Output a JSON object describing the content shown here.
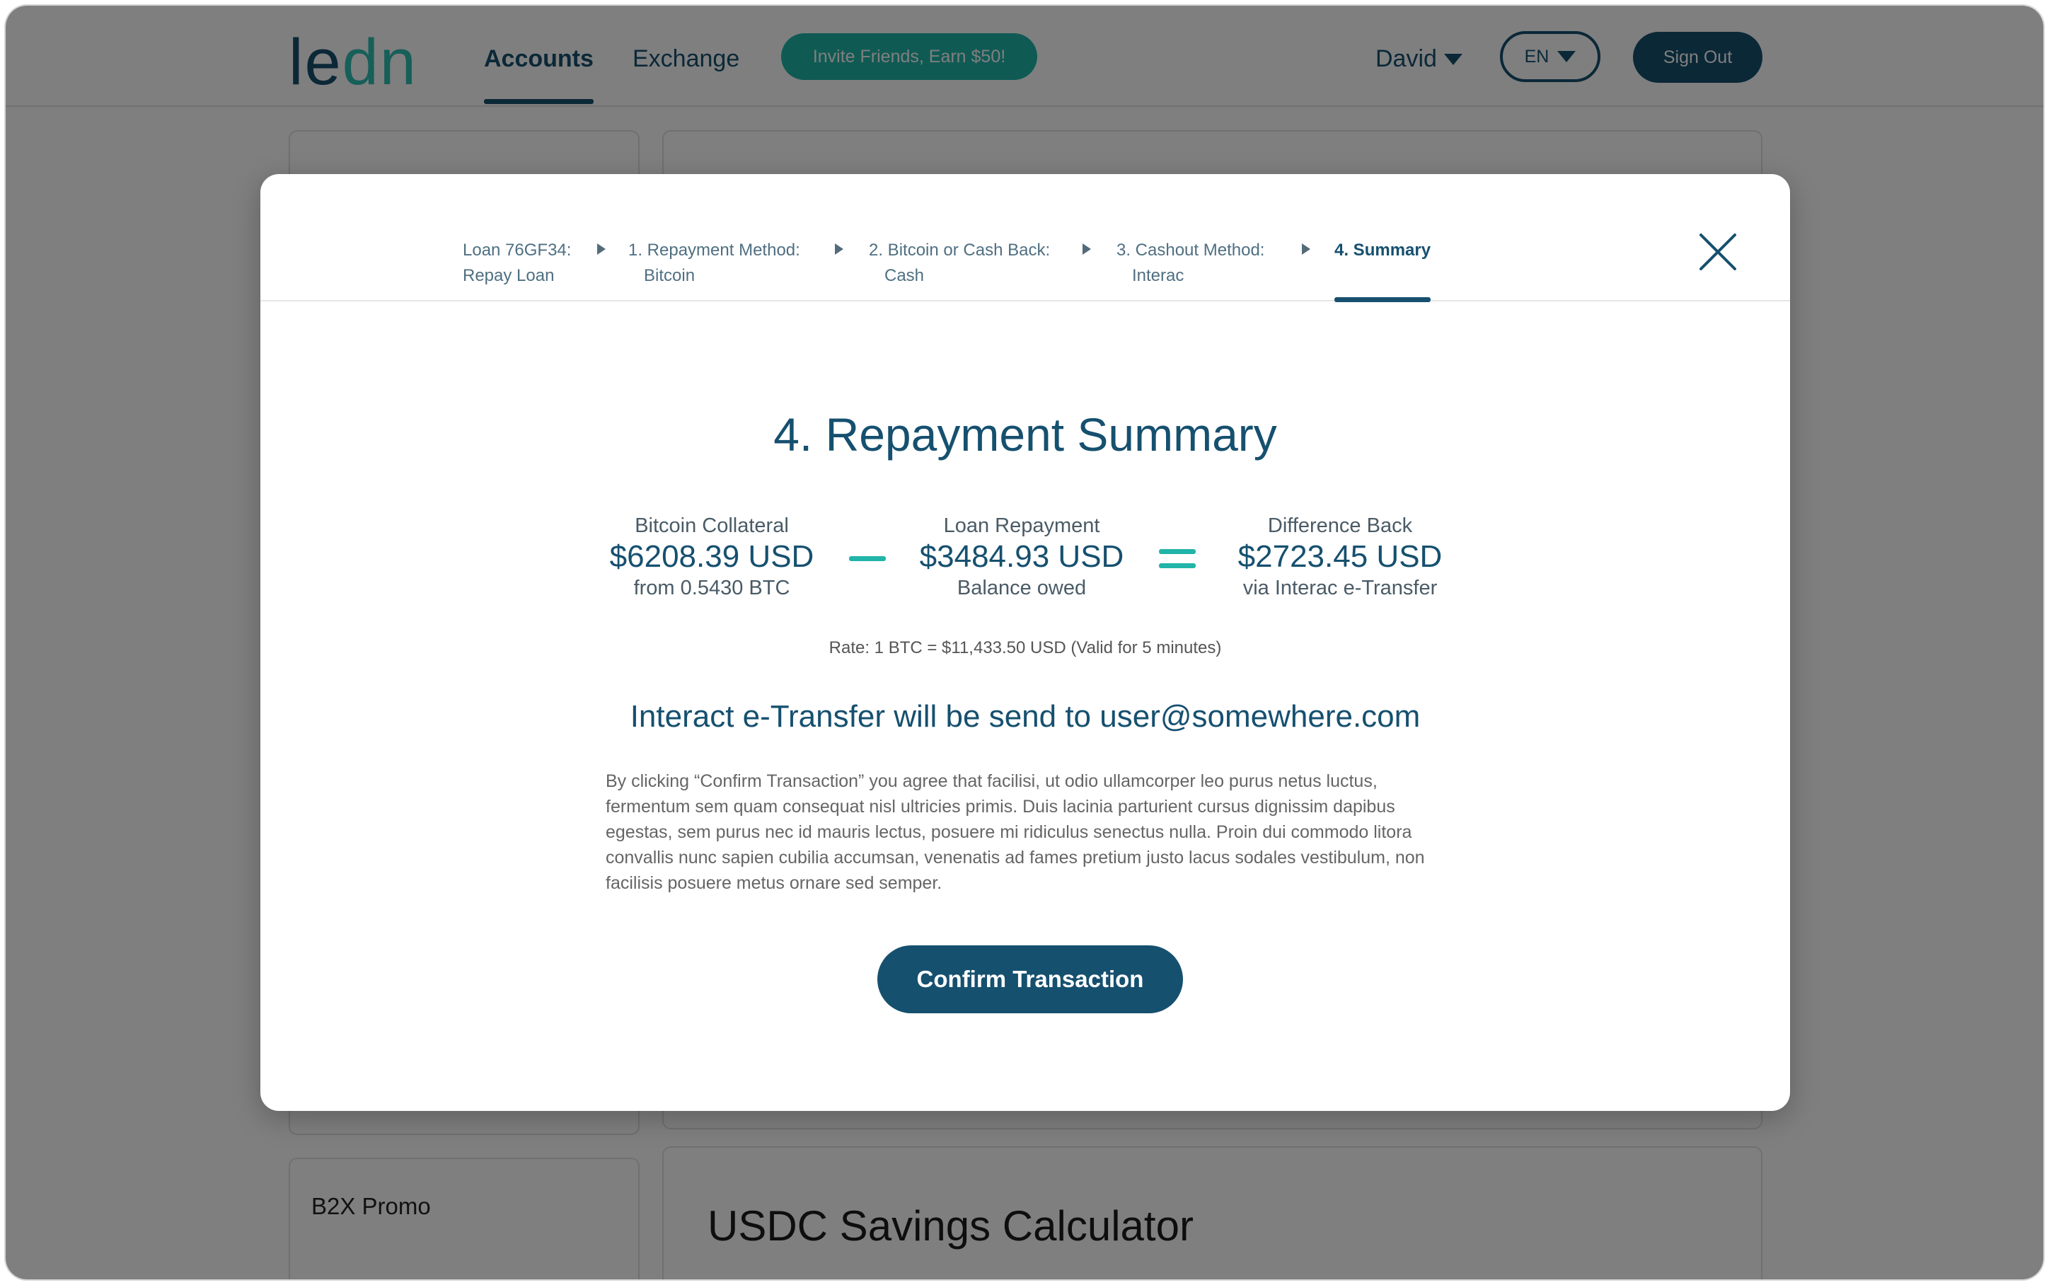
{
  "brand": {
    "logo_part1": "le",
    "logo_part2": "dn",
    "primary_color": "#16506f",
    "accent_color": "#21b4a8"
  },
  "nav": {
    "tabs": [
      {
        "label": "Accounts",
        "active": true
      },
      {
        "label": "Exchange",
        "active": false
      }
    ],
    "invite_label": "Invite Friends, Earn $50!",
    "user_name": "David",
    "language": "EN",
    "sign_out_label": "Sign Out"
  },
  "background": {
    "promo_card_title": "B2X Promo",
    "calculator_title": "USDC Savings Calculator"
  },
  "modal": {
    "steps": [
      {
        "line1": "Loan 76GF34:",
        "line2": "Repay Loan"
      },
      {
        "line1": "1. Repayment Method:",
        "line2": "Bitcoin"
      },
      {
        "line1": "2. Bitcoin or Cash Back:",
        "line2": "Cash"
      },
      {
        "line1": "3. Cashout Method:",
        "line2": "Interac"
      },
      {
        "line1": "4. Summary",
        "line2": "",
        "active": true
      }
    ],
    "title": "4. Repayment Summary",
    "collateral": {
      "label": "Bitcoin Collateral",
      "amount": "$6208.39 USD",
      "sub": "from 0.5430 BTC"
    },
    "repayment": {
      "label": "Loan Repayment",
      "amount": "$3484.93 USD",
      "sub": "Balance owed"
    },
    "difference": {
      "label": "Difference Back",
      "amount": "$2723.45 USD",
      "sub": "via Interac e-Transfer"
    },
    "rate": "Rate: 1 BTC = $11,433.50 USD (Valid for 5 minutes)",
    "transfer_notice": "Interact e-Transfer will be send to user@somewhere.com",
    "terms": "By clicking “Confirm Transaction” you agree that facilisi, ut odio ullamcorper leo purus netus luctus, fermentum sem quam consequat nisl ultricies primis. Duis lacinia parturient cursus dignissim dapibus egestas, sem purus nec id mauris lectus, posuere mi ridiculus senectus nulla. Proin dui commodo litora convallis nunc sapien cubilia accumsan, venenatis ad fames pretium justo lacus sodales vestibulum, non facilisis posuere metus ornare sed semper.",
    "confirm_label": "Confirm Transaction",
    "close_icon": "close-icon"
  }
}
